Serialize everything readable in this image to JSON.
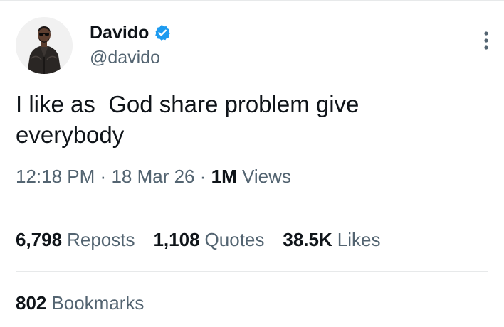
{
  "author": {
    "display_name": "Davido",
    "handle": "@davido",
    "verified": true,
    "avatar_icon": "profile-photo"
  },
  "post": {
    "text": "I like as  God share problem give everybody",
    "time": "12:18 PM",
    "date": "18 Mar 26",
    "views_count": "1M",
    "views_label": "Views",
    "separator": "·"
  },
  "stats": {
    "reposts_count": "6,798",
    "reposts_label": "Reposts",
    "quotes_count": "1,108",
    "quotes_label": "Quotes",
    "likes_count": "38.5K",
    "likes_label": "Likes",
    "bookmarks_count": "802",
    "bookmarks_label": "Bookmarks"
  },
  "icons": {
    "verified": "verified-badge-icon",
    "more": "more-options-icon"
  },
  "colors": {
    "text_primary": "#0f1419",
    "text_secondary": "#536471",
    "verified_blue": "#1d9bf0",
    "divider": "#e7e9ea"
  }
}
